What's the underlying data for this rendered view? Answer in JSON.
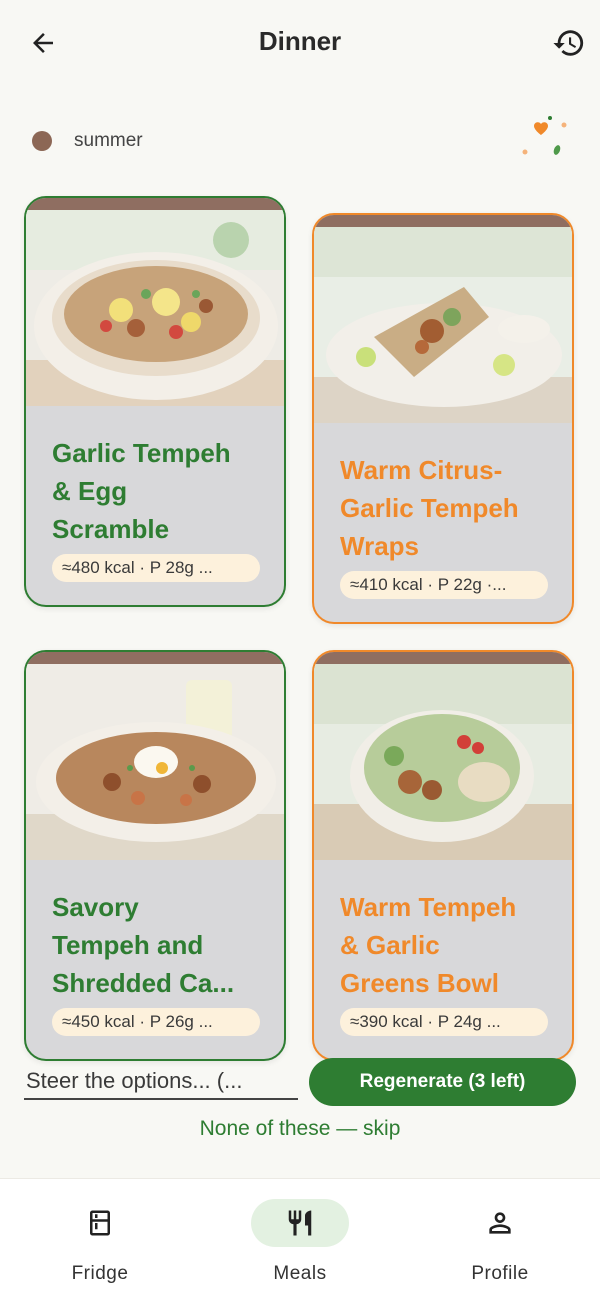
{
  "header": {
    "title": "Dinner",
    "back_icon": "arrow-left-icon",
    "history_icon": "history-icon"
  },
  "season": {
    "label": "summer",
    "dot_color": "#8c6755"
  },
  "colors": {
    "green_accent": "#2e7d32",
    "orange_accent": "#f0892a",
    "card_tab": "#8f6e61",
    "pill_bg": "#fdf1dc"
  },
  "meals": [
    {
      "name_lines": [
        "Garlic Tempeh",
        "& Egg",
        "Scramble"
      ],
      "nutrition": "≈480 kcal · P 28g ...",
      "accent": "green"
    },
    {
      "name_lines": [
        "Warm Citrus-",
        "Garlic Tempeh",
        "Wraps"
      ],
      "nutrition": "≈410 kcal · P 22g ·...",
      "accent": "orange"
    },
    {
      "name_lines": [
        "Savory",
        "Tempeh and",
        "Shredded Ca..."
      ],
      "nutrition": "≈450 kcal · P 26g ...",
      "accent": "green"
    },
    {
      "name_lines": [
        "Warm Tempeh",
        "& Garlic",
        "Greens Bowl"
      ],
      "nutrition": "≈390 kcal · P 24g ...",
      "accent": "orange"
    }
  ],
  "controls": {
    "steer_placeholder": "Steer the options... (...",
    "regenerate_label": "Regenerate (3 left)",
    "skip_label": "None of these — skip"
  },
  "nav": {
    "items": [
      {
        "label": "Fridge",
        "icon": "fridge-icon",
        "active": false
      },
      {
        "label": "Meals",
        "icon": "utensils-icon",
        "active": true
      },
      {
        "label": "Profile",
        "icon": "person-icon",
        "active": false
      }
    ]
  }
}
